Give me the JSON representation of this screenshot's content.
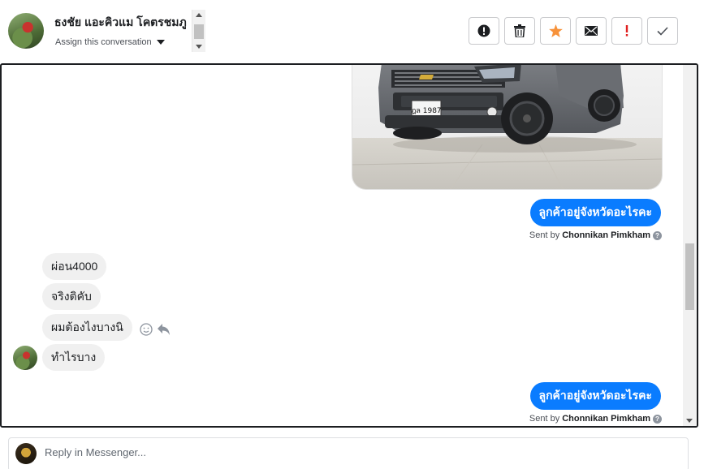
{
  "header": {
    "contact_name": "ธงชัย แอะคิวแม โคตรชมภู",
    "assign_label": "Assign this conversation"
  },
  "toolbar": {
    "buttons": [
      {
        "name": "spam-alert-button",
        "icon": "alert-circle-icon"
      },
      {
        "name": "delete-button",
        "icon": "trash-icon"
      },
      {
        "name": "star-button",
        "icon": "star-icon",
        "color": "#f7923a"
      },
      {
        "name": "email-button",
        "icon": "envelope-icon"
      },
      {
        "name": "important-button",
        "icon": "exclamation-icon",
        "color": "#e02020"
      },
      {
        "name": "done-button",
        "icon": "check-icon"
      }
    ]
  },
  "conversation": {
    "image": {
      "alt_plate": "ฎล 1987"
    },
    "outgoing_1": {
      "text": "ลูกค้าอยู่จังหวัดอะไรคะ",
      "sent_by_prefix": "Sent by",
      "sender": "Chonnikan Pimkham"
    },
    "incoming": [
      {
        "text": "ผ่อน4000"
      },
      {
        "text": "จริงติคับ"
      },
      {
        "text": "ผมต้องไงบางนิ"
      },
      {
        "text": "ทำไรบาง"
      }
    ],
    "outgoing_2": {
      "text": "ลูกค้าอยู่จังหวัดอะไรคะ",
      "sent_by_prefix": "Sent by",
      "sender": "Chonnikan Pimkham"
    }
  },
  "reply": {
    "placeholder": "Reply in Messenger..."
  },
  "colors": {
    "outgoing_bubble": "#0a7cff",
    "incoming_bubble": "#f0f0f0",
    "star": "#f7923a",
    "important": "#e02020"
  }
}
